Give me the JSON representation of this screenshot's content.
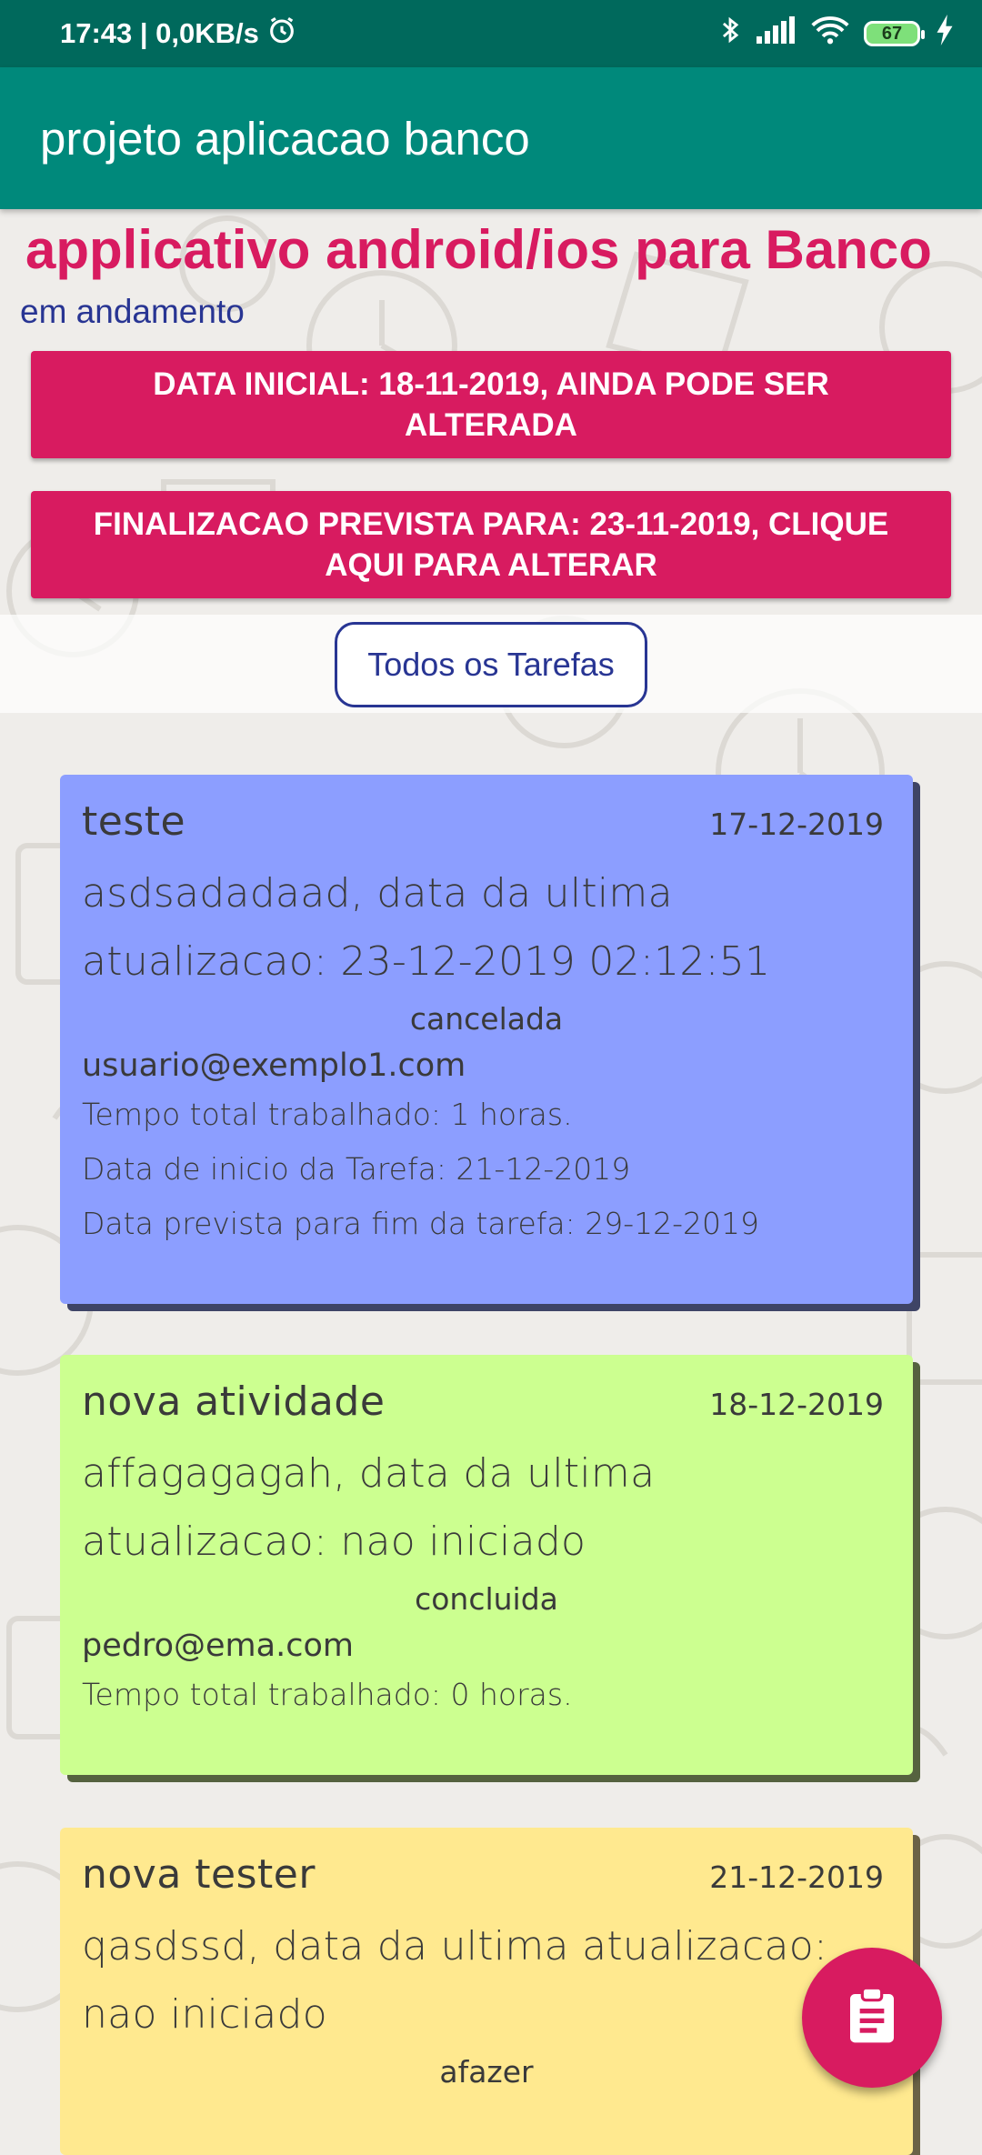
{
  "status_bar": {
    "time": "17:43 | 0,0KB/s",
    "battery": "67"
  },
  "app_bar": {
    "title": "projeto aplicacao banco"
  },
  "project": {
    "title": "applicativo android/ios para Banco",
    "status": "em andamento",
    "start_button": "DATA INICIAL: 18-11-2019, AINDA PODE SER ALTERADA",
    "end_button": "FINALIZACAO PREVISTA PARA: 23-11-2019, CLIQUE AQUI PARA ALTERAR",
    "filter_button": "Todos os Tarefas"
  },
  "tasks": [
    {
      "name": "teste",
      "date": "17-12-2019",
      "description": "asdsadadaad, data da ultima atualizacao: 23-12-2019 02:12:51",
      "state": "cancelada",
      "user": "usuario@exemplo1.com",
      "total_time": "Tempo total trabalhado: 1 horas.",
      "start_date": "Data de inicio da Tarefa: 21-12-2019",
      "end_date": "Data prevista para fim da tarefa: 29-12-2019",
      "color": "#8c9eff"
    },
    {
      "name": "nova atividade",
      "date": "18-12-2019",
      "description": "affagagagah, data da ultima atualizacao: nao iniciado",
      "state": "concluida",
      "user": "pedro@ema.com",
      "total_time": "Tempo total trabalhado: 0 horas.",
      "color": "#ccff90"
    },
    {
      "name": "nova tester",
      "date": "21-12-2019",
      "description": "qasdssd, data da ultima atualizacao: nao iniciado",
      "state": "afazer",
      "color": "#ffe98f"
    }
  ],
  "colors": {
    "status_bar": "#00695c",
    "app_bar": "#00897b",
    "accent": "#d81b60",
    "indigo": "#283593"
  },
  "icons": [
    "alarm-icon",
    "bluetooth-icon",
    "signal-icon",
    "wifi-icon",
    "battery-icon",
    "charging-icon",
    "clipboard-icon"
  ]
}
